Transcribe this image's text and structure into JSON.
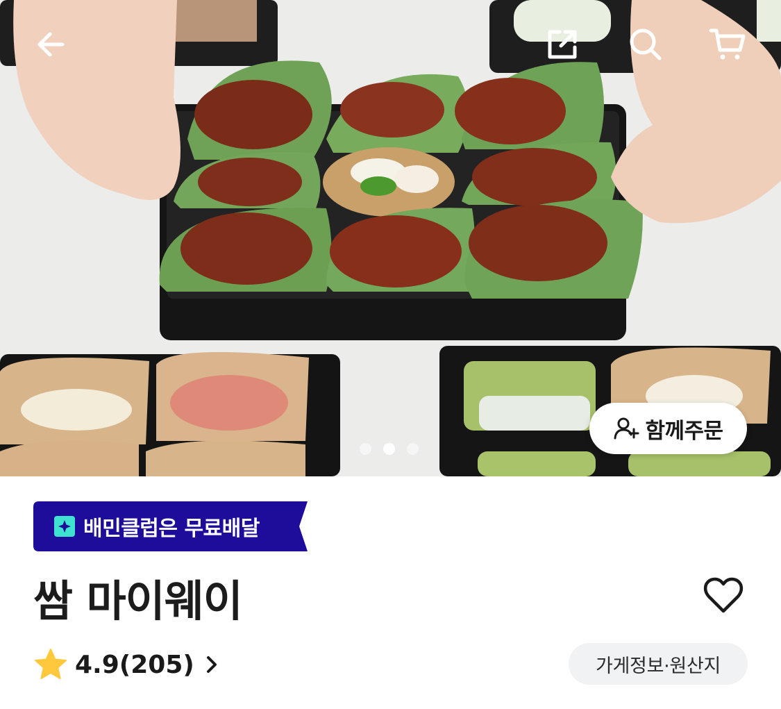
{
  "hero": {
    "carousel": {
      "total": 3,
      "active_index": 1
    },
    "group_order_label": "함께주문"
  },
  "toolbar": {
    "back_icon": "arrow-left-icon",
    "share_icon": "share-icon",
    "search_icon": "search-icon",
    "cart_icon": "cart-icon"
  },
  "store": {
    "club_badge_text": "배민클럽은 무료배달",
    "club_badge_color": "#1d0d9a",
    "name": "쌈 마이웨이",
    "rating_text": "4.9(205)",
    "star_color": "#ffc83d",
    "info_button_label": "가게정보·원산지",
    "favorite_icon": "heart-icon"
  }
}
